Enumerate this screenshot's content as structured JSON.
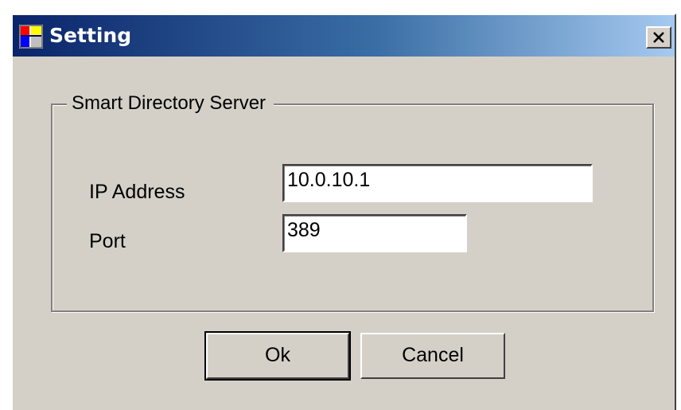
{
  "window": {
    "title": "Setting",
    "icon": "app-window-icon",
    "close_icon": "close-icon",
    "colors": {
      "title_start": "#0a246a",
      "title_end": "#a6caf0",
      "face": "#d4d0c8"
    }
  },
  "group": {
    "legend": "Smart Directory Server"
  },
  "fields": {
    "ip_label": "IP Address",
    "ip_value": "10.0.10.1",
    "port_label": "Port",
    "port_value": "389"
  },
  "buttons": {
    "ok_label": "Ok",
    "cancel_label": "Cancel"
  }
}
